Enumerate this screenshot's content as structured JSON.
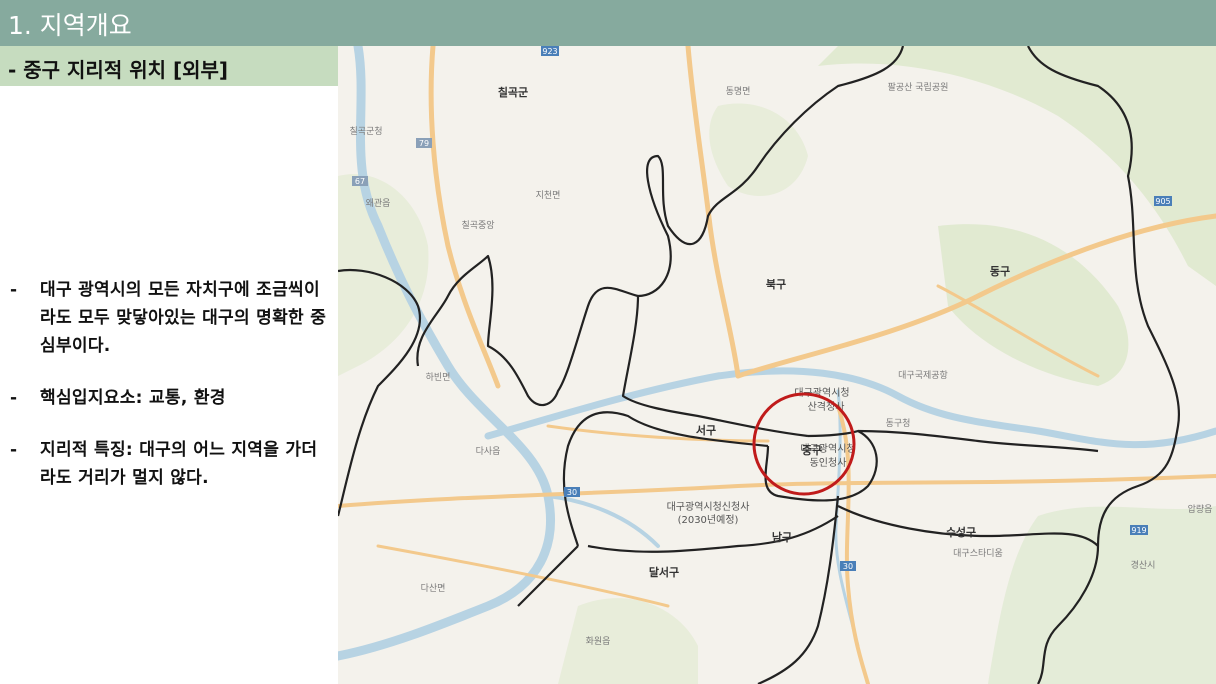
{
  "header": {
    "title": "1. 지역개요"
  },
  "subheader": {
    "title": "- 중구 지리적 위치 [외부]"
  },
  "bullets": [
    {
      "dash": "-",
      "text": "대구 광역시의 모든 자치구에 조금씩이라도 모두 맞닿아있는 대구의 명확한 중심부이다."
    },
    {
      "dash": "-",
      "text": "핵심입지요소: 교통, 환경"
    },
    {
      "dash": "-",
      "text": "지리적 특징: 대구의 어느 지역을 가더라도 거리가 멀지 않다."
    }
  ],
  "map": {
    "districts": {
      "chilgok": "칠곡군",
      "buk": "북구",
      "dong": "동구",
      "seo": "서구",
      "jung": "중구",
      "nam": "남구",
      "suseong": "수성구",
      "dalseo": "달서구"
    },
    "places": {
      "dongmyeon": "동명면",
      "jicheon": "지천면",
      "waegwan": "왜관읍",
      "haban": "하빈면",
      "dasa": "다사읍",
      "dasamyeon": "다산면",
      "hwawon": "화원읍",
      "gyeongsan": "경산시",
      "apryang": "압량읍",
      "chilgokgun": "칠곡군청",
      "chilgok_station": "칠곡중앙",
      "sanjeok": "산격청사",
      "cityhall1": "대구광역시청",
      "cityhall2": "대구광역시청",
      "dongin": "동인청사",
      "newhall1": "대구광역시청신청사",
      "newhall2": "(2030년예정)",
      "stadium": "대구스타디움",
      "donga": "동구청",
      "airport": "대구국제공항",
      "park": "팔공산 국립공원"
    },
    "route_labels": [
      "923",
      "79",
      "67",
      "30",
      "30",
      "919",
      "905"
    ],
    "colors": {
      "land": "#f4f2ec",
      "green": "#dfe9cf",
      "water": "#b7d3e3",
      "road": "#f3c98c",
      "boundary": "#222222",
      "circle": "#c01b1b"
    }
  }
}
